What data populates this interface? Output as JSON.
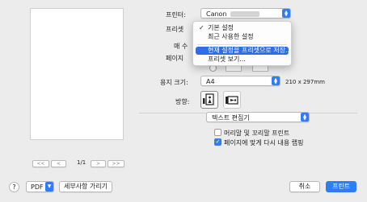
{
  "preview": {
    "first_label": "<<",
    "prev_label": "<",
    "page_indicator": "1/1",
    "next_label": ">",
    "last_label": ">>"
  },
  "printer": {
    "label": "프린터:",
    "value": "Canon"
  },
  "presets": {
    "label": "프리셋",
    "menu_items": [
      {
        "label": "기본 설정",
        "checked": true
      },
      {
        "label": "최근 사용한 설정",
        "checked": false
      },
      {
        "label": "현재 설정을 프리셋으로 저장...",
        "highlighted": true
      },
      {
        "label": "프리셋 보기...",
        "checked": false
      }
    ]
  },
  "copies": {
    "label_partial": "매 수"
  },
  "pages": {
    "label_partial": "페이지"
  },
  "paper_size": {
    "label": "용지 크기:",
    "value": "A4",
    "dimensions": "210 x 297mm"
  },
  "orientation": {
    "label": "방향:"
  },
  "section_select": {
    "value": "텍스트 편집기"
  },
  "options": {
    "header_footer": {
      "label": "머리말 및 꼬리말 프린트",
      "checked": false
    },
    "rewrap": {
      "label": "페이지에 맞게 다시 내용 랩핑",
      "checked": true
    }
  },
  "footer": {
    "help_label": "?",
    "pdf_label": "PDF",
    "hide_details_label": "세부사항 가리기",
    "cancel_label": "취소",
    "print_label": "프린트"
  },
  "colors": {
    "accent": "#2f7df6",
    "highlight": "#2c6ee6",
    "background": "#ececec"
  }
}
